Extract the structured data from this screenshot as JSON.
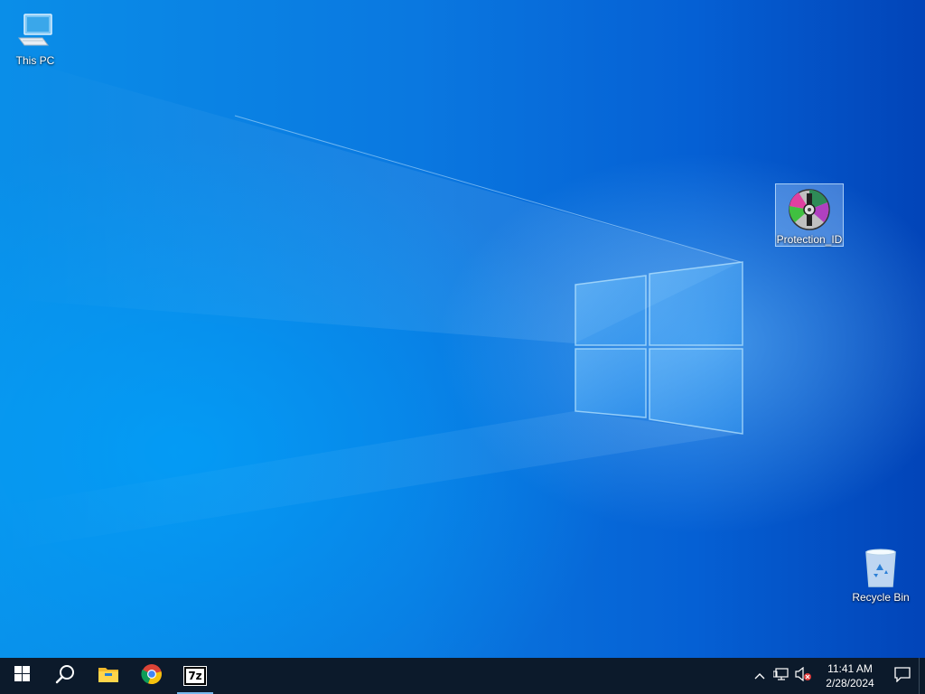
{
  "desktop": {
    "icons": [
      {
        "label": "This PC",
        "icon": "this-pc-icon"
      },
      {
        "label": "Protection_ID",
        "icon": "protection-id-icon"
      },
      {
        "label": "Recycle Bin",
        "icon": "recycle-bin-icon"
      }
    ]
  },
  "taskbar": {
    "start": {
      "icon": "windows-start-icon"
    },
    "search": {
      "icon": "search-icon"
    },
    "apps": [
      {
        "name": "File Explorer",
        "icon": "file-explorer-icon"
      },
      {
        "name": "Google Chrome",
        "icon": "chrome-icon"
      },
      {
        "name": "7-Zip",
        "icon": "7zip-icon",
        "glyph": "7z"
      }
    ],
    "tray": {
      "chevron_glyph": "^",
      "network_icon": "network-icon",
      "volume_icon": "volume-muted-icon"
    },
    "clock": {
      "time": "11:41 AM",
      "date": "2/28/2024"
    },
    "notification_icon": "action-center-icon"
  },
  "colors": {
    "taskbar": "#0c1a2b",
    "desktop_light": "#0a8ee8",
    "desktop_dark": "#0244b8",
    "active_indicator": "#76b9ed"
  }
}
